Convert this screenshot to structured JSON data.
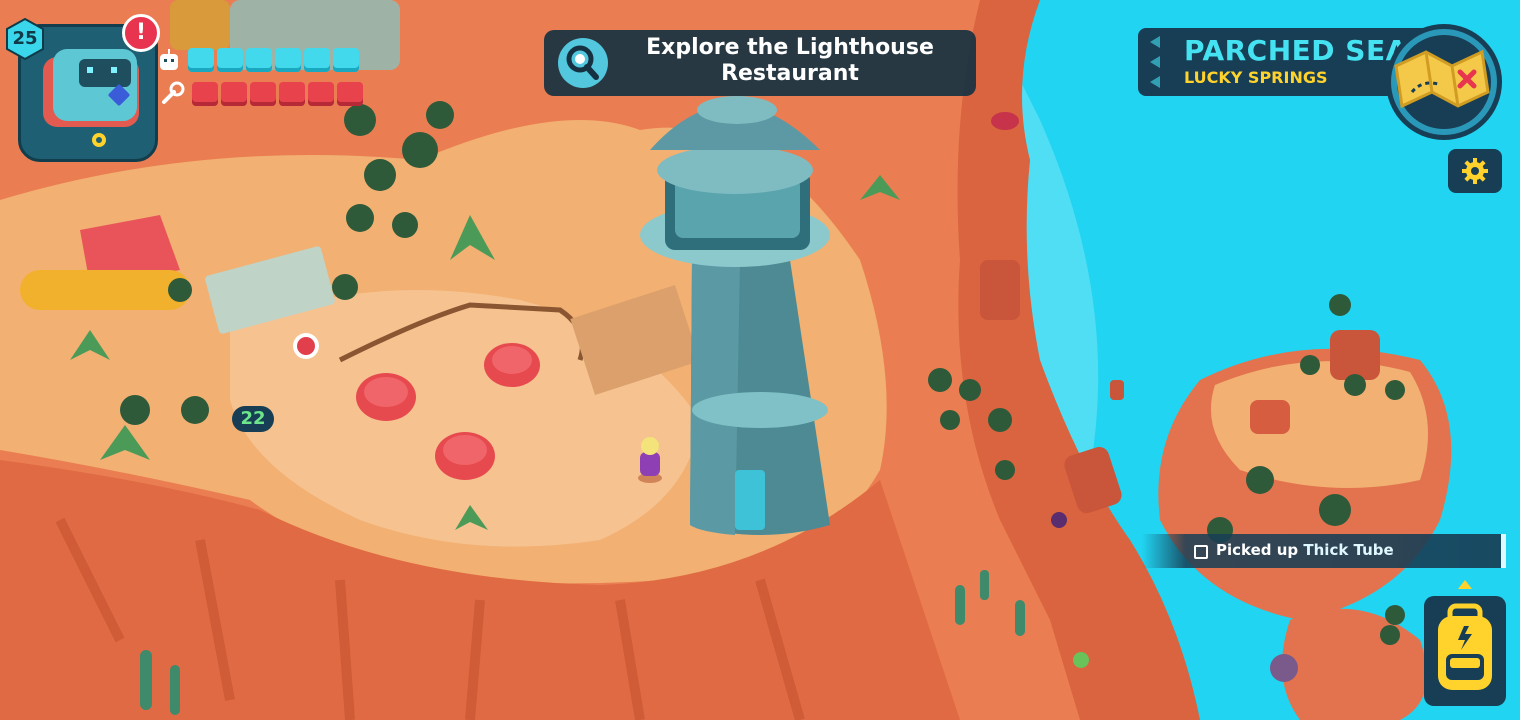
{
  "player": {
    "level": "25",
    "alert_glyph": "!",
    "energy_segments": 6,
    "tool_segments": 6,
    "icons": {
      "portrait": "robot-avatar-icon",
      "energy": "robot-head-icon",
      "tools": "wrench-icon",
      "alert": "exclamation-icon"
    }
  },
  "objective": {
    "title": "Explore the Lighthouse Restaurant",
    "icon": "magnifier-search-icon"
  },
  "region": {
    "name": "PARCHED SEA",
    "area": "LUCKY SPRINGS",
    "map_icon": "folded-map-icon"
  },
  "settings": {
    "icon": "gear-icon"
  },
  "notification": {
    "prefix": "Picked up",
    "item": "Thick Tube"
  },
  "backpack": {
    "icon": "backpack-icon"
  },
  "npc": {
    "level": "22"
  },
  "colors": {
    "sea": "#21d4f2",
    "sand": "#f2b072",
    "rock": "#e2734e",
    "hud_panel": "#173e55",
    "energy": "#43d9ec",
    "tools": "#e8434d",
    "accent_yellow": "#ffd32c"
  }
}
